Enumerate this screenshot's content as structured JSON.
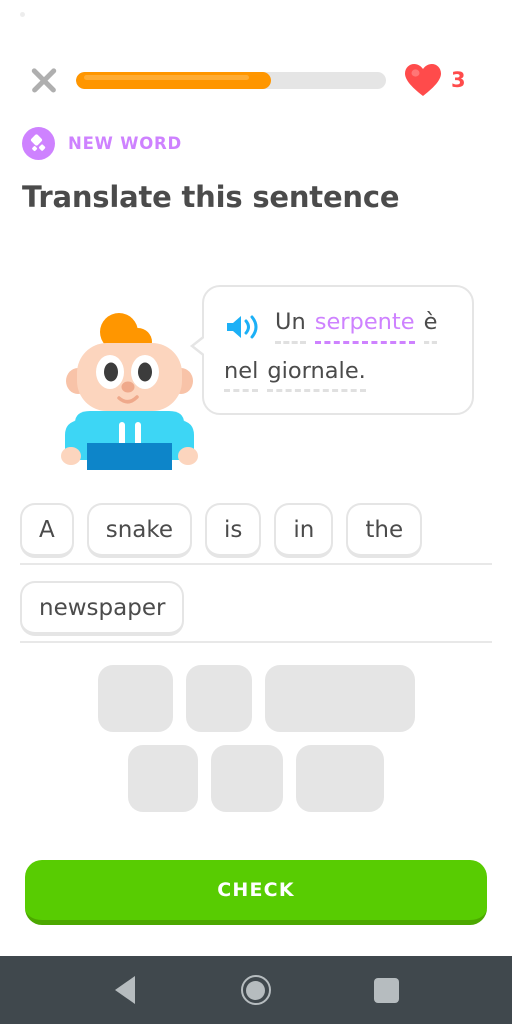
{
  "app": {
    "title": "Duolingo Lesson",
    "background_color": "#FFFFFF"
  },
  "colors": {
    "duo_green": "#58CC02",
    "duo_green_shadow": "#4CA800",
    "progress_orange": "#FF9600",
    "progress_orange_light": "#FFAC33",
    "track_gray": "#E5E5E5",
    "heart_red": "#FF4B4B",
    "new_word_purple": "#CE82FF",
    "speaker_blue": "#1CB0F6",
    "text_dark": "#4B4B4B",
    "close_gray": "#AFAFAF",
    "navbar_dark": "#40484D",
    "navbar_icon": "#B6BCBF"
  },
  "topbar": {
    "close_label": "×",
    "close_icon": "close-x-icon",
    "progress_percent": 63,
    "hearts_icon": "heart-icon",
    "hearts_count": "3"
  },
  "badge": {
    "icon": "new-word-diamond-icon",
    "label": "NEW WORD"
  },
  "title": {
    "text": "Translate this sentence"
  },
  "prompt": {
    "character": "duo-junior-character",
    "speaker_icon": "speaker-audio-icon",
    "line1": [
      {
        "text": "Un",
        "style": "normal"
      },
      {
        "text": "serpente",
        "style": "highlight"
      },
      {
        "text": "è",
        "style": "normal"
      }
    ],
    "line2": [
      {
        "text": "nel",
        "style": "normal"
      },
      {
        "text": "giornale.",
        "style": "normal"
      }
    ],
    "full_sentence": "Un serpente è nel giornale."
  },
  "answer": {
    "row1": [
      "A",
      "snake",
      "is",
      "in",
      "the"
    ],
    "row2": [
      "newspaper"
    ],
    "assembled": "A snake is in the newspaper"
  },
  "word_bank": {
    "row1_widths": [
      80,
      70,
      150
    ],
    "row2_widths": [
      80,
      80,
      90
    ]
  },
  "check": {
    "label": "CHECK"
  },
  "navbar": {
    "back": "back-triangle-icon",
    "home": "home-circle-icon",
    "recents": "recents-square-icon"
  }
}
